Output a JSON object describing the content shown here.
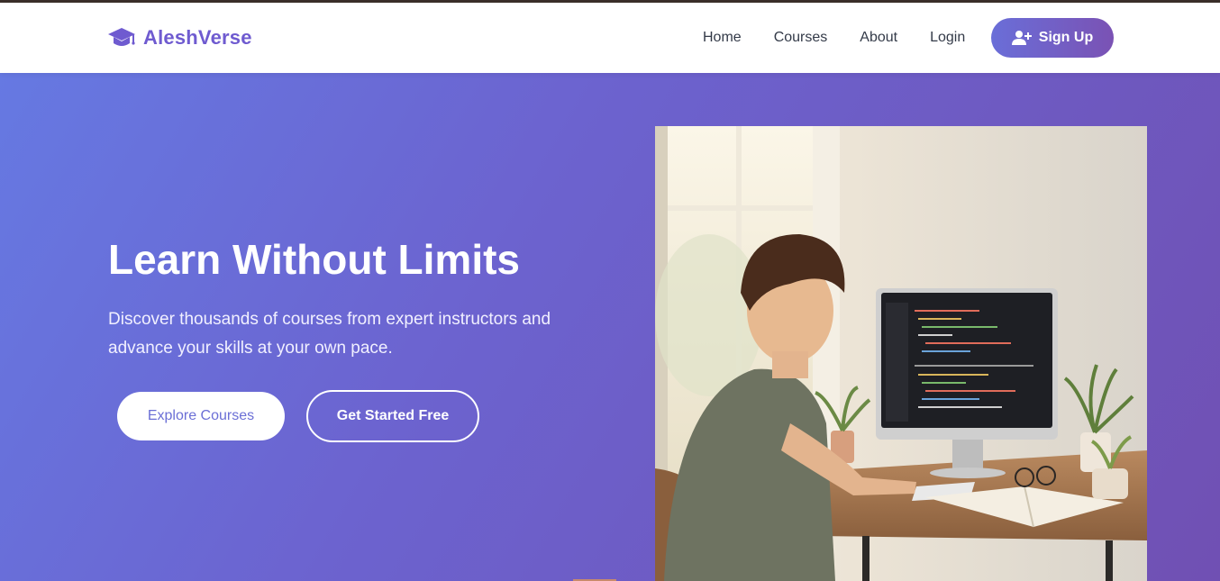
{
  "brand": {
    "name": "AleshVerse",
    "icon": "graduation-cap-icon",
    "color": "#6f5bd0"
  },
  "nav": {
    "items": [
      {
        "label": "Home"
      },
      {
        "label": "Courses"
      },
      {
        "label": "About"
      },
      {
        "label": "Login"
      }
    ],
    "signup": {
      "label": "Sign Up",
      "icon": "user-plus-icon"
    }
  },
  "hero": {
    "title": "Learn Without Limits",
    "subtitle": "Discover thousands of courses from expert instructors and advance your skills at your own pace.",
    "primary_button": "Explore Courses",
    "secondary_button": "Get Started Free",
    "gradient": [
      "#6679e2",
      "#7050b3"
    ]
  },
  "colors": {
    "accent": "#6b6fd6",
    "nav_text": "#333a48"
  }
}
